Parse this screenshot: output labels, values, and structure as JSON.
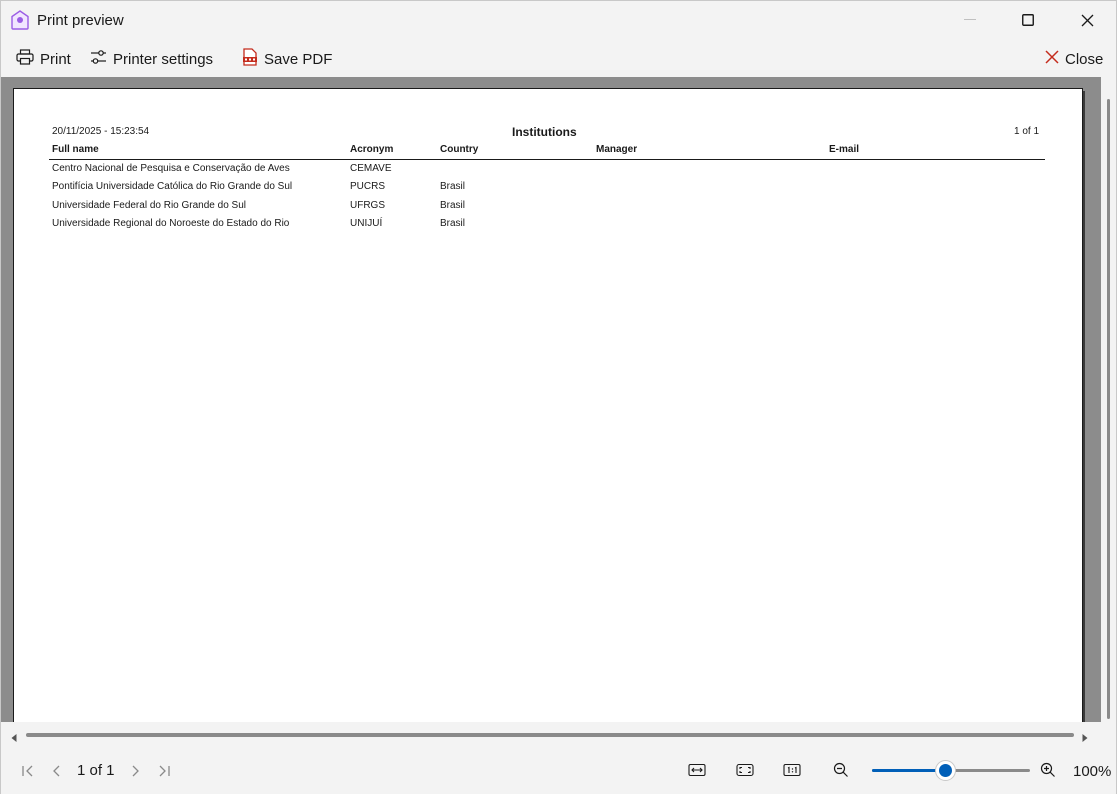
{
  "window": {
    "title": "Print preview",
    "icon": "app-house-icon",
    "accent": "#005fb8"
  },
  "toolbar": {
    "print_label": "Print",
    "settings_label": "Printer settings",
    "pdf_label": "Save PDF",
    "close_label": "Close"
  },
  "report": {
    "timestamp": "20/11/2025 - 15:23:54",
    "title": "Institutions",
    "page_info": "1 of 1",
    "columns": [
      "Full name",
      "Acronym",
      "Country",
      "Manager",
      "E-mail"
    ],
    "rows": [
      [
        "Centro Nacional de Pesquisa e Conservação de Aves",
        "CEMAVE",
        "",
        "",
        ""
      ],
      [
        "Pontifícia Universidade Católica do Rio Grande do Sul",
        "PUCRS",
        "Brasil",
        "",
        ""
      ],
      [
        "Universidade Federal do Rio Grande do Sul",
        "UFRGS",
        "Brasil",
        "",
        ""
      ],
      [
        "Universidade Regional do Noroeste do Estado do Rio",
        "UNIJUÍ",
        "Brasil",
        "",
        ""
      ]
    ]
  },
  "statusbar": {
    "page_indicator": "1 of 1",
    "zoom_label": "100%",
    "zoom_fraction": 0.47
  }
}
